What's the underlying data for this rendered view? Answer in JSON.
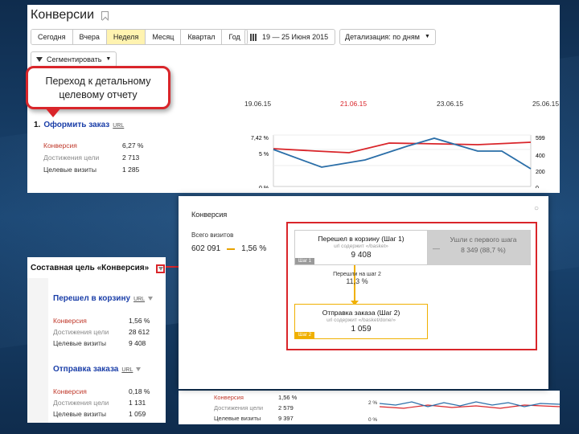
{
  "page": {
    "title": "Конверсии"
  },
  "period_tabs": [
    {
      "label": "Сегодня",
      "active": false
    },
    {
      "label": "Вчера",
      "active": false
    },
    {
      "label": "Неделя",
      "active": true
    },
    {
      "label": "Месяц",
      "active": false
    },
    {
      "label": "Квартал",
      "active": false
    },
    {
      "label": "Год",
      "active": false
    }
  ],
  "date_range": "19 — 25 Июня 2015",
  "detail": "Детализация: по дням",
  "segment_button": "Сегментировать",
  "callout": "Переход к детальному целевому отчету",
  "dates": [
    "19.06.15",
    "21.06.15",
    "23.06.15",
    "25.06.15"
  ],
  "goal": {
    "number": "1.",
    "name": "Оформить заказ",
    "url_tag": "URL",
    "metrics": [
      {
        "label": "Конверсия",
        "value": "6,27 %"
      },
      {
        "label": "Достижения цели",
        "value": "2 713"
      },
      {
        "label": "Целевые визиты",
        "value": "1 285"
      }
    ]
  },
  "chart_data": {
    "type": "line",
    "y_left_ticks": [
      "7,42 %",
      "5 %",
      "0 %"
    ],
    "y_right_ticks": [
      "599",
      "400",
      "200",
      "0"
    ],
    "series": [],
    "grid": true
  },
  "left_card": {
    "title": "Составная цель «Конверсия»",
    "goals": [
      {
        "name": "Перешел в корзину",
        "url_tag": "URL",
        "metrics": [
          {
            "label": "Конверсия",
            "value": "1,56 %"
          },
          {
            "label": "Достижения цели",
            "value": "28 612"
          },
          {
            "label": "Целевые визиты",
            "value": "9 408"
          }
        ]
      },
      {
        "name": "Отправка заказа",
        "url_tag": "URL",
        "metrics": [
          {
            "label": "Конверсия",
            "value": "0,18 %"
          },
          {
            "label": "Достижения цели",
            "value": "1 131"
          },
          {
            "label": "Целевые визиты",
            "value": "1 059"
          }
        ]
      }
    ]
  },
  "modal": {
    "title": "Конверсия",
    "close": "○",
    "total_visits_label": "Всего визитов",
    "total_visits": "602 091",
    "total_conversion": "1,56 %",
    "step1": {
      "title": "Перешел в корзину (Шаг 1)",
      "url": "url содержит «/basket»",
      "value": "9 408",
      "tag": "Шаг 1"
    },
    "leave_text": "Ушли с первого шага",
    "leave_value": "8 349 (88,7 %)",
    "leave_dash": "—",
    "mid_label": "Перешли на шаг 2",
    "mid_value": "11,3 %",
    "step2": {
      "title": "Отправка заказа (Шаг 2)",
      "url": "url содержит «/basket/done/»",
      "value": "1 059",
      "tag": "Шаг 2"
    }
  },
  "under": {
    "rows": [
      {
        "label": "Конверсия",
        "value": "1,56 %"
      },
      {
        "label": "Достижения цели",
        "value": "2 579"
      },
      {
        "label": "Целевые визиты",
        "value": "9 397"
      }
    ],
    "ticks": [
      "2 %",
      "0 %"
    ]
  }
}
